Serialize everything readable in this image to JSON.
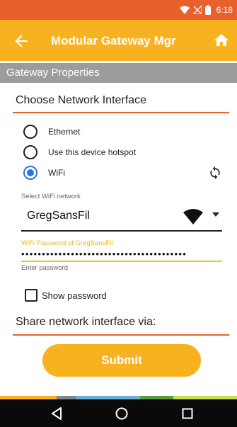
{
  "status_bar": {
    "time": "6:18",
    "icons": [
      "wifi-icon",
      "no-signal-icon",
      "battery-icon"
    ]
  },
  "toolbar": {
    "title": "Modular Gateway Mgr",
    "back_icon": "arrow-left-icon",
    "home_icon": "home-icon"
  },
  "section": {
    "title": "Gateway Properties"
  },
  "network_interface": {
    "heading": "Choose Network Interface",
    "options": [
      {
        "label": "Ethernet",
        "checked": false
      },
      {
        "label": "Use this device hotspot",
        "checked": false
      },
      {
        "label": "WiFi",
        "checked": true
      }
    ],
    "refresh_icon": "refresh-icon"
  },
  "wifi": {
    "select_label": "Select WiFi network",
    "selected_network": "GregSansFil",
    "password_label": "WiFi Password of GregSansFil",
    "password_value": "••••••••••••••••••••••••••••••••••••••••",
    "password_hint": "Enter password"
  },
  "show_password": {
    "label": "Show password",
    "checked": false
  },
  "share": {
    "heading": "Share network interface via:"
  },
  "submit": {
    "label": "Submit"
  },
  "colors": {
    "status_bar": "#e8602c",
    "toolbar": "#f9b21f",
    "section_bar": "#9c9c9c",
    "accent": "#e8602c",
    "radio_checked": "#2a76d6",
    "password_underline": "#f0c419"
  }
}
